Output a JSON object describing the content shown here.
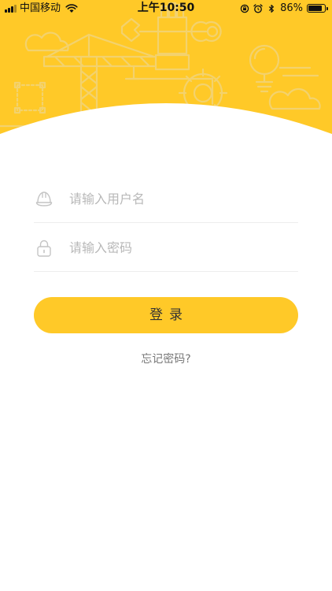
{
  "status_bar": {
    "carrier": "中国移动",
    "time": "上午10:50",
    "battery_text": "86%",
    "battery_level": 0.86
  },
  "colors": {
    "brand": "#FFC928",
    "brand_dark": "#F0B81E",
    "line": "#F5E08A",
    "placeholder": "#B8B8B8"
  },
  "form": {
    "username": {
      "icon": "helmet-icon",
      "placeholder": "请输入用户名",
      "value": ""
    },
    "password": {
      "icon": "lock-icon",
      "placeholder": "请输入密码",
      "value": ""
    },
    "login_label": "登录",
    "forgot_label": "忘记密码?"
  }
}
